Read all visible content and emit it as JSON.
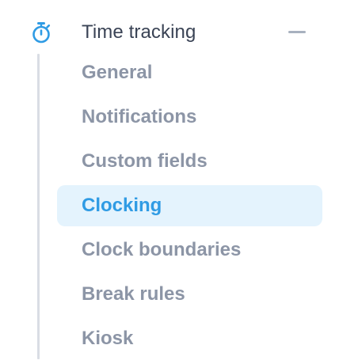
{
  "section": {
    "title": "Time tracking",
    "icon": "stopwatch-icon",
    "collapse_icon": "minus-icon"
  },
  "items": [
    {
      "label": "General",
      "active": false
    },
    {
      "label": "Notifications",
      "active": false
    },
    {
      "label": "Custom fields",
      "active": false
    },
    {
      "label": "Clocking",
      "active": true
    },
    {
      "label": "Clock boundaries",
      "active": false
    },
    {
      "label": "Break rules",
      "active": false
    },
    {
      "label": "Kiosk",
      "active": false
    }
  ],
  "colors": {
    "accent": "#2f9be4",
    "active_background": "#e4f3fd",
    "header_text": "#3a4355",
    "item_text": "#8c95a6",
    "tree_line": "#d9dde4"
  }
}
